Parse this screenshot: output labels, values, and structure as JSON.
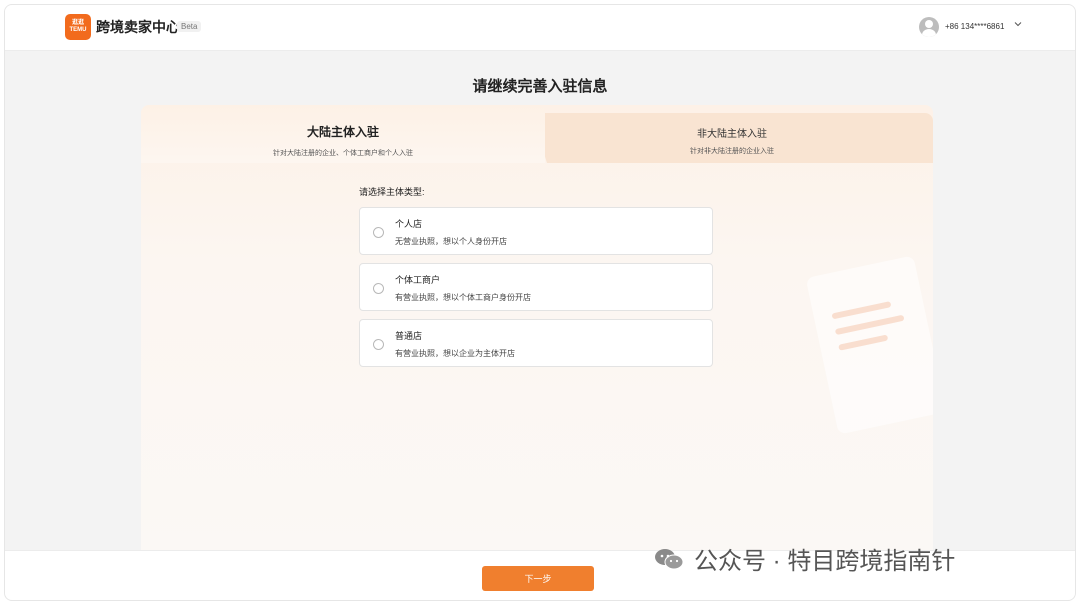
{
  "header": {
    "logo_top": "逛逛",
    "logo_bottom": "TEMU",
    "app_title": "跨境卖家中心",
    "beta": "Beta",
    "user_phone": "+86 134****6861"
  },
  "page_title": "请继续完善入驻信息",
  "tabs": [
    {
      "title": "大陆主体入驻",
      "subtitle": "针对大陆注册的企业、个体工商户和个人入驻",
      "active": true
    },
    {
      "title": "非大陆主体入驻",
      "subtitle": "针对非大陆注册的企业入驻",
      "active": false
    }
  ],
  "section_label": "请选择主体类型:",
  "options": [
    {
      "title": "个人店",
      "desc": "无营业执照，想以个人身份开店"
    },
    {
      "title": "个体工商户",
      "desc": "有营业执照，想以个体工商户身份开店"
    },
    {
      "title": "普通店",
      "desc": "有营业执照，想以企业为主体开店"
    }
  ],
  "footer": {
    "next_label": "下一步"
  },
  "watermark": "公众号 · 特目跨境指南针",
  "colors": {
    "brand": "#f26b1d",
    "button": "#f07f2e",
    "tab_active_bg": "#fdf1e6",
    "tab_inactive_bg": "#f9e4d2"
  }
}
